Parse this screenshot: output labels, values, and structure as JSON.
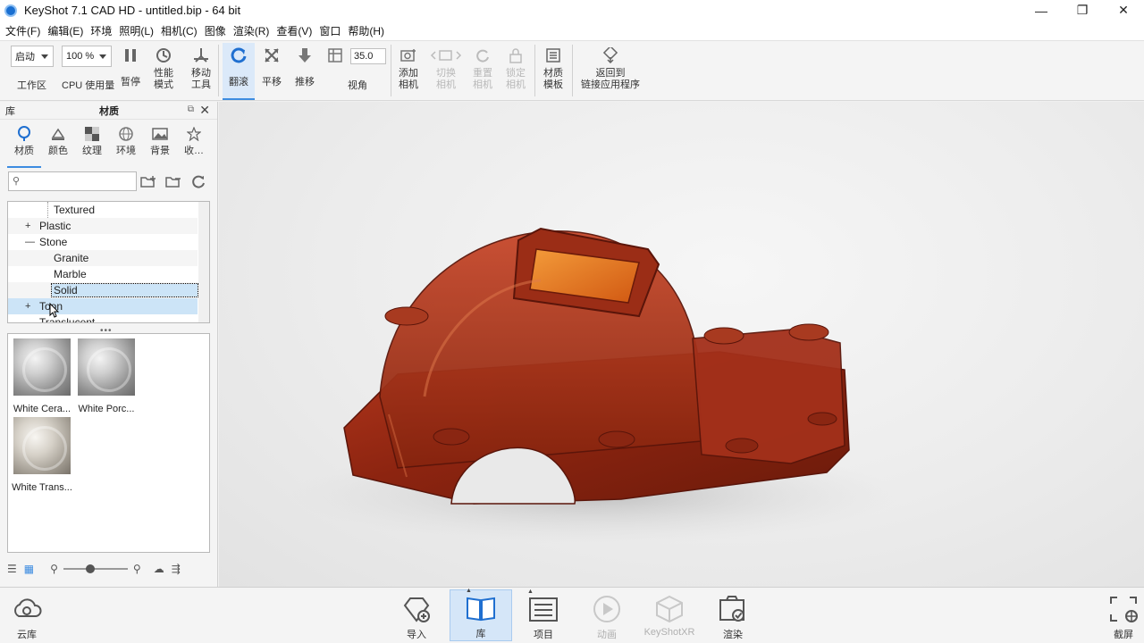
{
  "window": {
    "title": "KeyShot 7.1 CAD HD  - untitled.bip  - 64 bit",
    "controls": {
      "minimize": "—",
      "restore": "❐",
      "close": "✕"
    }
  },
  "menu": [
    "文件(F)",
    "编辑(E)",
    "环境",
    "照明(L)",
    "相机(C)",
    "图像",
    "渲染(R)",
    "查看(V)",
    "窗口",
    "帮助(H)"
  ],
  "toolbar": {
    "workspace_value": "启动",
    "workspace_label": "工作区",
    "cpu_value": "100 %",
    "cpu_label": "CPU  使用量",
    "pause_label": "暂停",
    "perf_mode_label1": "性能",
    "perf_mode_label2": "模式",
    "move_tool_label1": "移动",
    "move_tool_label2": "工具",
    "tumble_label": "翻滚",
    "pan_label": "平移",
    "dolly_label": "推移",
    "fov_value": "35.0",
    "fov_label": "视角",
    "add_camera_label1": "添加",
    "add_camera_label2": "相机",
    "switch_camera_label1": "切换",
    "switch_camera_label2": "相机",
    "reset_camera_label1": "重置",
    "reset_camera_label2": "相机",
    "lock_camera_label1": "锁定",
    "lock_camera_label2": "相机",
    "material_template_label1": "材质",
    "material_template_label2": "模板",
    "return_app_label1": "返回到",
    "return_app_label2": "链接应用程序"
  },
  "library": {
    "header_left": "库",
    "header_title": "材质",
    "tabs": [
      {
        "label": "材质",
        "icon": "material-icon"
      },
      {
        "label": "颜色",
        "icon": "color-icon"
      },
      {
        "label": "纹理",
        "icon": "texture-icon"
      },
      {
        "label": "环境",
        "icon": "environment-icon"
      },
      {
        "label": "背景",
        "icon": "background-icon"
      },
      {
        "label": "收…",
        "icon": "favorites-icon"
      }
    ],
    "search_placeholder": "",
    "tree": [
      {
        "label": "Textured"
      },
      {
        "label": "Plastic",
        "expander": "+"
      },
      {
        "label": "Stone",
        "expander": "—"
      },
      {
        "label": "Granite"
      },
      {
        "label": "Marble"
      },
      {
        "label": "Solid"
      },
      {
        "label": "Toon",
        "expander": "+"
      },
      {
        "label": "Translucent"
      }
    ],
    "thumbnails": [
      {
        "label": "White Cera..."
      },
      {
        "label": "White Porc..."
      },
      {
        "label": "White Trans..."
      }
    ],
    "zoom_level": 0.4
  },
  "bottom": {
    "cloud_label": "云库",
    "import_label": "导入",
    "library_label": "库",
    "project_label": "项目",
    "animation_label": "动画",
    "xr_label": "KeyShotXR",
    "render_label": "渲染",
    "screenshot_label": "截屏"
  }
}
